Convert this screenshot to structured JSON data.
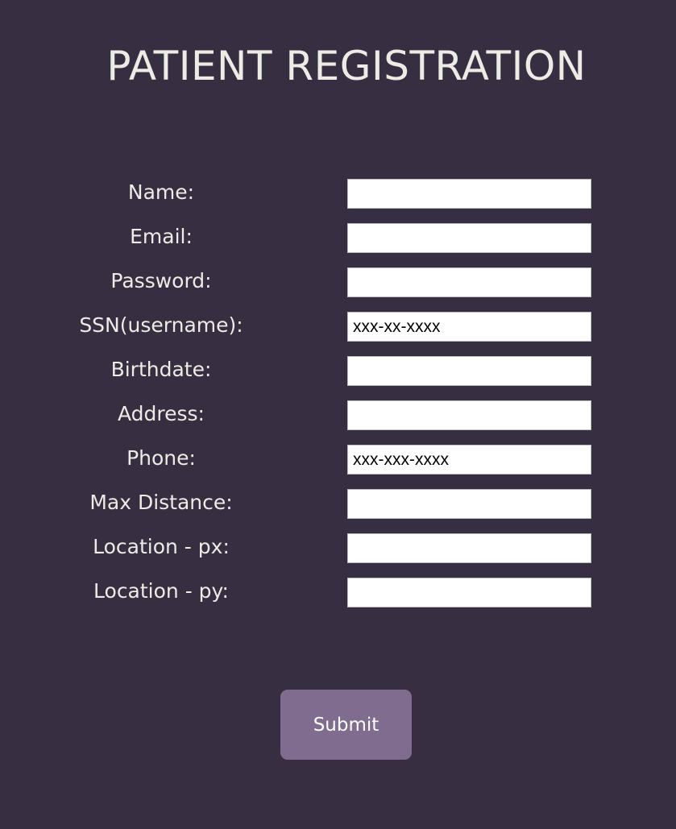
{
  "page": {
    "title": "PATIENT REGISTRATION"
  },
  "form": {
    "fields": [
      {
        "label": "Name:",
        "value": "",
        "placeholder": ""
      },
      {
        "label": "Email:",
        "value": "",
        "placeholder": ""
      },
      {
        "label": "Password:",
        "value": "",
        "placeholder": ""
      },
      {
        "label": "SSN(username):",
        "value": "",
        "placeholder": "xxx-xx-xxxx"
      },
      {
        "label": "Birthdate:",
        "value": "",
        "placeholder": ""
      },
      {
        "label": "Address:",
        "value": "",
        "placeholder": ""
      },
      {
        "label": "Phone:",
        "value": "",
        "placeholder": "xxx-xxx-xxxx"
      },
      {
        "label": "Max Distance:",
        "value": "",
        "placeholder": ""
      },
      {
        "label": "Location - px:",
        "value": "",
        "placeholder": ""
      },
      {
        "label": "Location - py:",
        "value": "",
        "placeholder": ""
      }
    ],
    "submit_label": "Submit"
  },
  "colors": {
    "background": "#382e42",
    "text": "#ecebe4",
    "button": "#806c8f",
    "input_background": "#ffffff"
  }
}
